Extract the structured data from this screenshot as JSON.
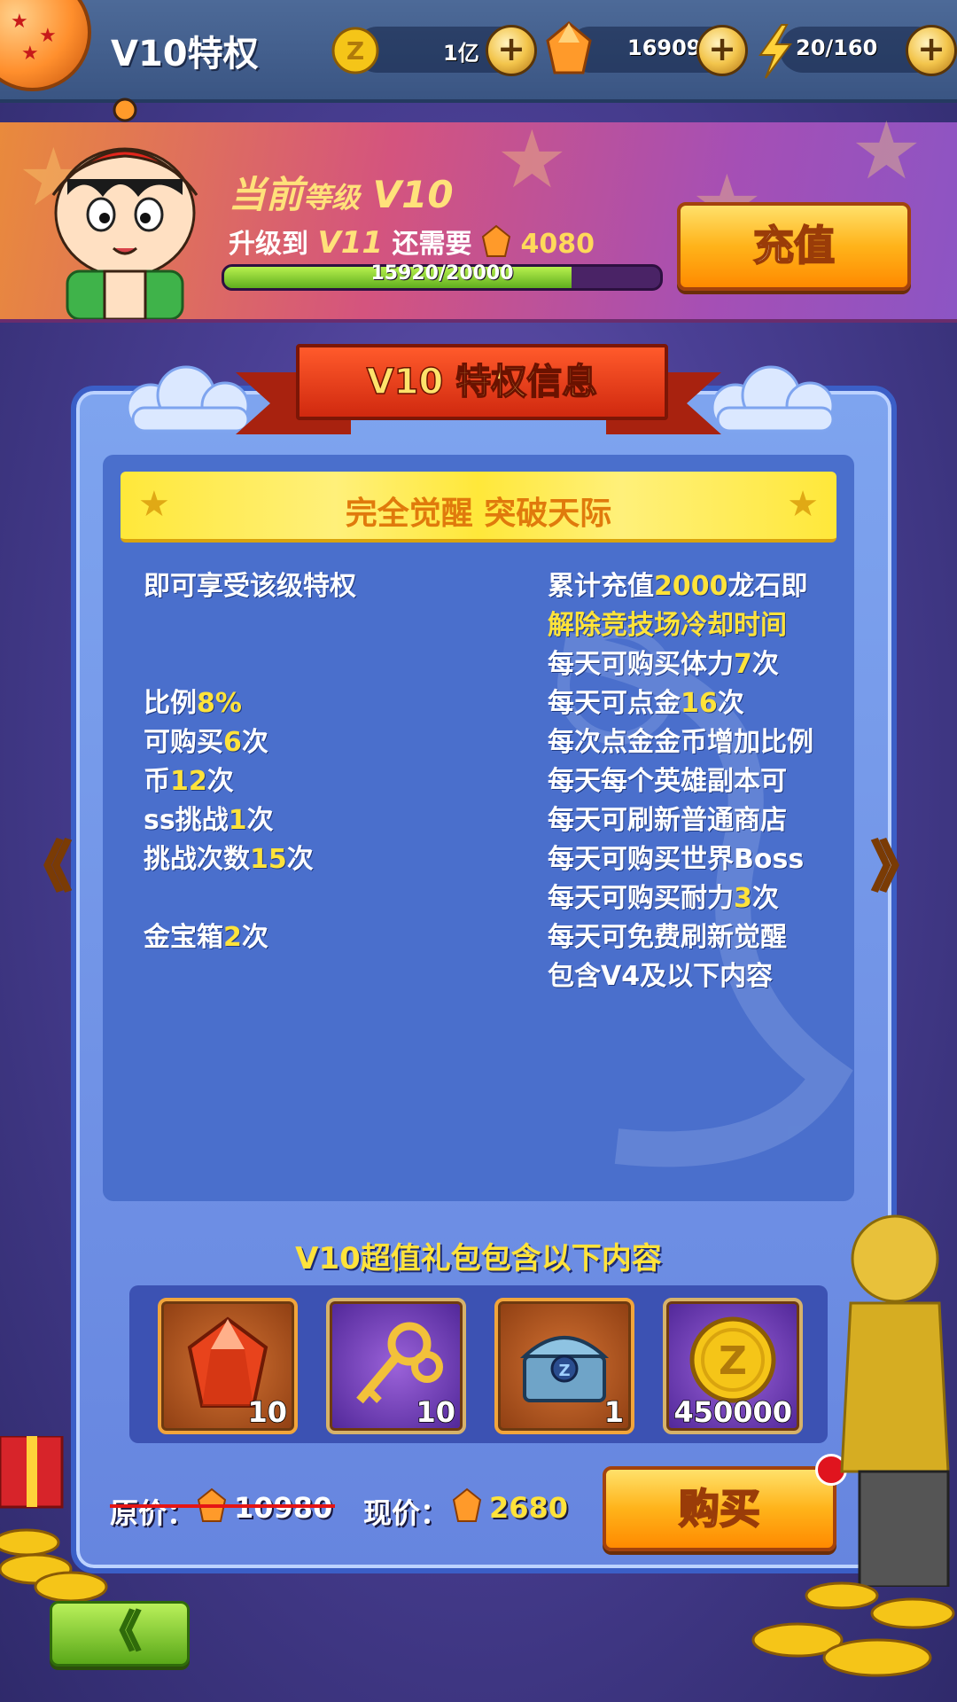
{
  "topbar": {
    "title": "V10特权",
    "gold": "1亿",
    "gems": "16909",
    "stamina": "20/160"
  },
  "vip": {
    "current_label_a": "当前",
    "current_label_b": "等级",
    "current_level": "V10",
    "upgrade_prefix": "升级到",
    "next_level": "V11",
    "upgrade_suffix": "还需要",
    "needed": "4080",
    "progress_text": "15920/20000",
    "progress_fraction": 0.796,
    "recharge_label": "充值"
  },
  "panel": {
    "title": "V10 特权信息",
    "banner": "完全觉醒 突破天际",
    "left_lines": [
      {
        "text": "即可享受该级特权",
        "hl": ""
      },
      {
        "text": "比例",
        "hl": "8%"
      },
      {
        "text": "可购买",
        "hl": "6",
        "suffix": "次"
      },
      {
        "text": "币",
        "hl": "12",
        "suffix": "次"
      },
      {
        "text": "ss挑战",
        "hl": "1",
        "suffix": "次"
      },
      {
        "text": "挑战次数",
        "hl": "15",
        "suffix": "次"
      },
      {
        "text": "金宝箱",
        "hl": "2",
        "suffix": "次"
      }
    ],
    "right_lines": [
      {
        "pre": "累计充值",
        "hl": "2000",
        "post": "龙石即"
      },
      {
        "hl_full": "解除竞技场冷却时间"
      },
      {
        "pre": "每天可购买体力",
        "hl": "7",
        "post": "次"
      },
      {
        "pre": "每天可点金",
        "hl": "16",
        "post": "次"
      },
      {
        "pre": "每次点金金币增加比例"
      },
      {
        "pre": "每天每个英雄副本可"
      },
      {
        "pre": "每天可刷新普通商店"
      },
      {
        "pre": "每天可购买世界Boss"
      },
      {
        "pre": "每天可购买耐力",
        "hl": "3",
        "post": "次"
      },
      {
        "pre": "每天可免费刷新觉醒"
      },
      {
        "pre": "包含V4及以下内容"
      }
    ]
  },
  "gift": {
    "title": "V10超值礼包包含以下内容",
    "items": [
      {
        "icon": "red-gem-icon",
        "qty": "10"
      },
      {
        "icon": "golden-key-icon",
        "qty": "10"
      },
      {
        "icon": "treasure-chest-icon",
        "qty": "1"
      },
      {
        "icon": "gold-coin-icon",
        "qty": "450000"
      }
    ]
  },
  "price": {
    "original_label": "原价：",
    "original_value": "10980",
    "current_label": "现价：",
    "current_value": "2680",
    "buy_label": "购买"
  },
  "nav": {
    "prev": "《",
    "next": "》",
    "back": "《"
  },
  "colors": {
    "highlight": "#ffe33a",
    "accent_orange": "#ff8a00",
    "panel_blue": "#4a6fcc"
  }
}
